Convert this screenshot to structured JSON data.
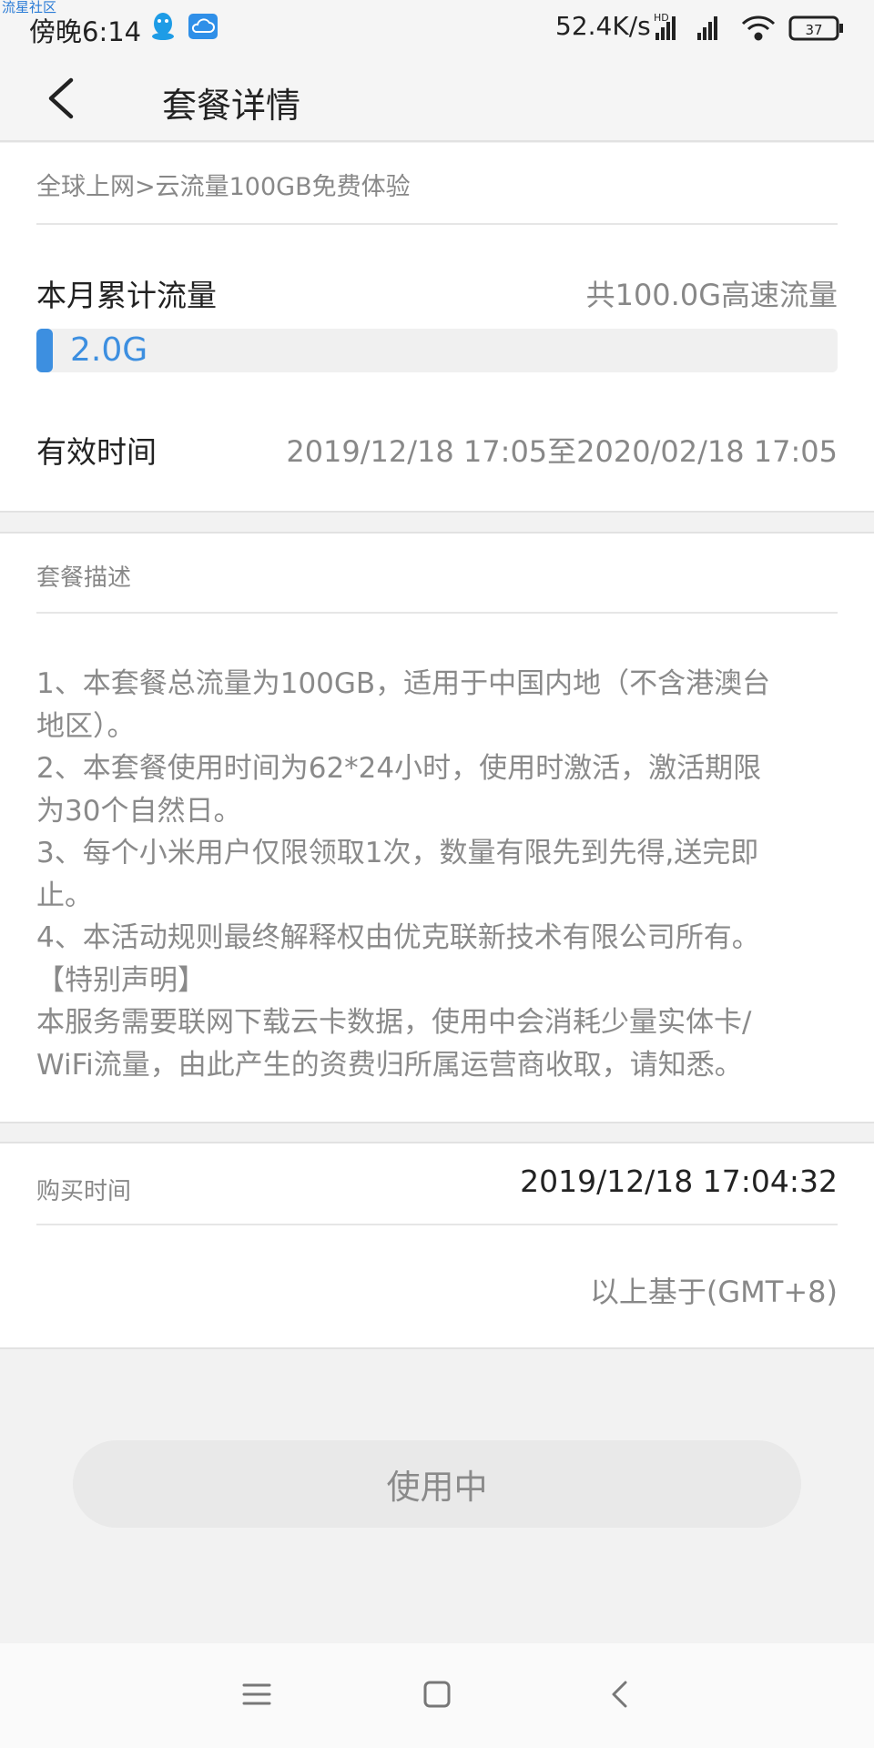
{
  "watermark": "流星社区",
  "status_bar": {
    "time": "傍晚6:14",
    "net_speed": "52.4K/s",
    "network_badge": "HD",
    "battery": "37",
    "icons": [
      "qq-icon",
      "cloud-icon",
      "signal-icon",
      "wifi-icon",
      "battery-icon"
    ]
  },
  "header": {
    "title": "套餐详情"
  },
  "package": {
    "breadcrumb": "全球上网>云流量100GB免费体验",
    "usage_label": "本月累计流量",
    "total_label": "共100.0G高速流量",
    "used_value": "2.0G",
    "used_fraction": 0.02,
    "validity_label": "有效时间",
    "validity_value": "2019/12/18 17:05至2020/02/18 17:05"
  },
  "description": {
    "label": "套餐描述",
    "lines": [
      "1、本套餐总流量为100GB，适用于中国内地（不含港澳台",
      "地区）。",
      "2、本套餐使用时间为62*24小时，使用时激活，激活期限",
      "为30个自然日。",
      "3、每个小米用户仅限领取1次，数量有限先到先得,送完即",
      "止。",
      "4、本活动规则最终解释权由优克联新技术有限公司所有。",
      "【特别声明】",
      "本服务需要联网下载云卡数据，使用中会消耗少量实体卡/",
      "WiFi流量，由此产生的资费归所属运营商收取，请知悉。"
    ]
  },
  "purchase": {
    "label": "购买时间",
    "value": "2019/12/18 17:04:32",
    "timezone_note": "以上基于(GMT+8)"
  },
  "status_button": {
    "label": "使用中"
  },
  "colors": {
    "accent": "#3d8fe0",
    "background": "#f2f2f2",
    "card": "#ffffff",
    "muted_text": "#888888"
  }
}
